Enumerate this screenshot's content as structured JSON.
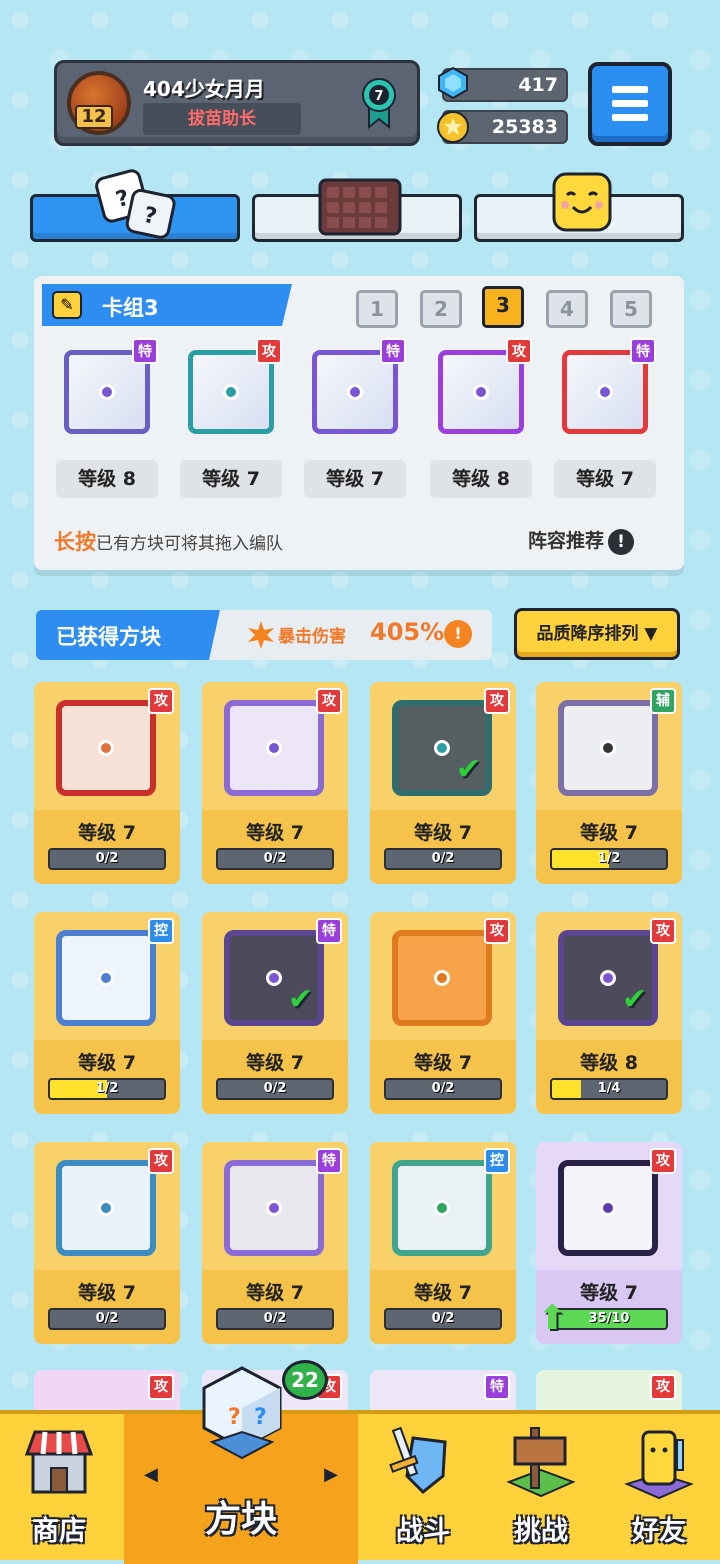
{
  "player": {
    "name": "404少女月月",
    "level": "12",
    "title": "拔苗助长",
    "rank": "7"
  },
  "resources": {
    "gems": "417",
    "coins": "25383"
  },
  "deck": {
    "title": "卡组3",
    "slots": [
      "1",
      "2",
      "3",
      "4",
      "5"
    ],
    "active_slot": "3",
    "cards": [
      {
        "tag": "特",
        "level": "等级 8"
      },
      {
        "tag": "攻",
        "level": "等级 7"
      },
      {
        "tag": "特",
        "level": "等级 7"
      },
      {
        "tag": "攻",
        "level": "等级 8"
      },
      {
        "tag": "特",
        "level": "等级 7"
      }
    ],
    "hint_emphasis": "长按",
    "hint_text": "已有方块可将其拖入编队",
    "recommend_label": "阵容推荐"
  },
  "owned": {
    "title": "已获得方块",
    "crit_label": "暴击伤害",
    "crit_value": "405%",
    "sort_label": "品质降序排列",
    "cards": [
      {
        "tag": "攻",
        "level": "等级 7",
        "progress": "0/2",
        "fill": 0,
        "equipped": false
      },
      {
        "tag": "攻",
        "level": "等级 7",
        "progress": "0/2",
        "fill": 0,
        "equipped": false
      },
      {
        "tag": "攻",
        "level": "等级 7",
        "progress": "0/2",
        "fill": 0,
        "equipped": true
      },
      {
        "tag": "辅",
        "level": "等级 7",
        "progress": "1/2",
        "fill": 0.5,
        "equipped": false
      },
      {
        "tag": "控",
        "level": "等级 7",
        "progress": "1/2",
        "fill": 0.5,
        "equipped": false
      },
      {
        "tag": "特",
        "level": "等级 7",
        "progress": "0/2",
        "fill": 0,
        "equipped": true
      },
      {
        "tag": "攻",
        "level": "等级 7",
        "progress": "0/2",
        "fill": 0,
        "equipped": false
      },
      {
        "tag": "攻",
        "level": "等级 8",
        "progress": "1/4",
        "fill": 0.25,
        "equipped": true
      },
      {
        "tag": "攻",
        "level": "等级 7",
        "progress": "0/2",
        "fill": 0,
        "equipped": false
      },
      {
        "tag": "特",
        "level": "等级 7",
        "progress": "0/2",
        "fill": 0,
        "equipped": false
      },
      {
        "tag": "控",
        "level": "等级 7",
        "progress": "0/2",
        "fill": 0,
        "equipped": false
      },
      {
        "tag": "攻",
        "level": "等级 7",
        "progress": "35/10",
        "fill": 1,
        "equipped": false,
        "upgradable": true
      }
    ],
    "partial_tags": [
      "攻",
      "攻",
      "特",
      "攻"
    ]
  },
  "nav": {
    "shop": "商店",
    "blocks": "方块",
    "battle": "战斗",
    "challenge": "挑战",
    "friends": "好友",
    "badge": "22"
  },
  "colors": {
    "accent": "#2e8df0",
    "attack": "#e23a3a",
    "special": "#9b3fdc",
    "support": "#2fa561",
    "control": "#2d8de8"
  }
}
